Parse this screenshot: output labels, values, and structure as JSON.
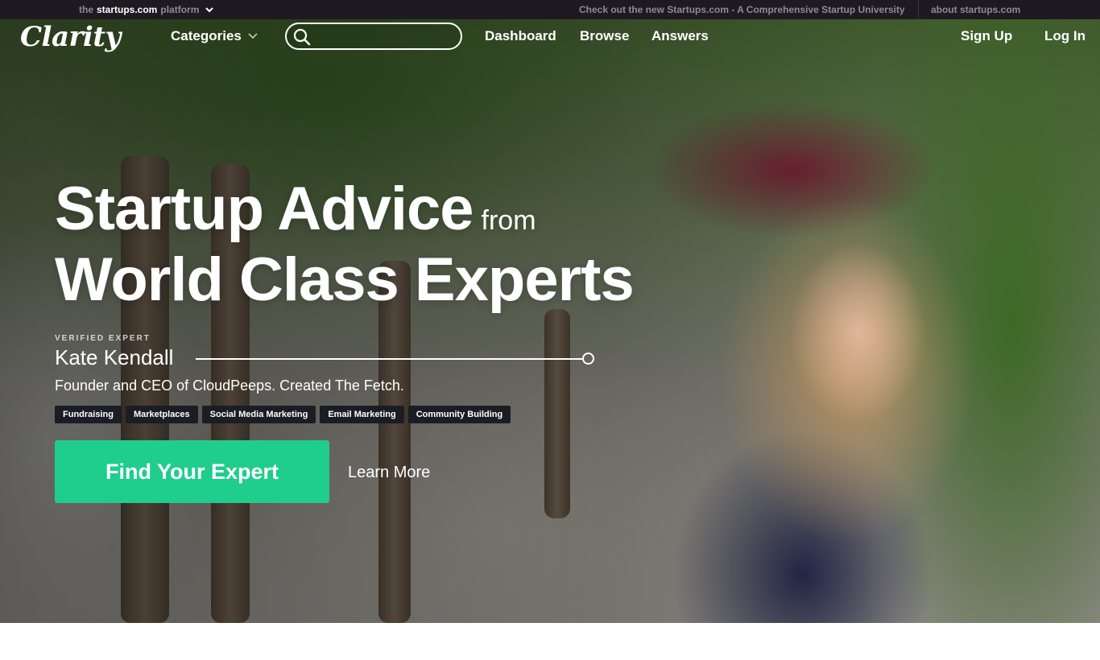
{
  "platform_bar": {
    "prefix": "the",
    "brand": "startups.com",
    "suffix": "platform",
    "promo": "Check out the new Startups.com - A Comprehensive Startup University",
    "about": "about startups.com"
  },
  "nav": {
    "logo": "Clarity",
    "categories": "Categories",
    "search": {
      "value": "",
      "placeholder": ""
    },
    "dashboard": "Dashboard",
    "browse": "Browse",
    "answers": "Answers",
    "signup": "Sign Up",
    "login": "Log In"
  },
  "hero": {
    "headline_main": "Startup Advice",
    "headline_from": "from",
    "headline_second": "World Class Experts",
    "verified_label": "VERIFIED EXPERT",
    "expert_name": "Kate Kendall",
    "expert_description": "Founder and CEO of CloudPeeps. Created The Fetch.",
    "tags": [
      "Fundraising",
      "Marketplaces",
      "Social Media Marketing",
      "Email Marketing",
      "Community Building"
    ],
    "cta": "Find Your Expert",
    "learn_more": "Learn More"
  },
  "colors": {
    "accent": "#1fcd8d",
    "topbar": "#1f1a21",
    "tag_bg": "#1a1d24"
  }
}
